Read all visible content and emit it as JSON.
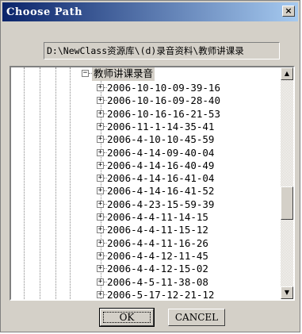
{
  "window": {
    "title": "Choose Path",
    "close_glyph": "×"
  },
  "path": "D:\\NewClass资源库\\(d)录音资料\\教师讲课录",
  "tree": {
    "root": {
      "expander": "−",
      "label": "教师讲课录音"
    },
    "items": [
      "2006-10-10-09-39-16",
      "2006-10-16-09-28-40",
      "2006-10-16-16-21-53",
      "2006-11-1-14-35-41",
      "2006-4-10-10-45-59",
      "2006-4-14-09-40-04",
      "2006-4-14-16-40-49",
      "2006-4-14-16-41-04",
      "2006-4-14-16-41-52",
      "2006-4-23-15-59-39",
      "2006-4-4-11-14-15",
      "2006-4-4-11-15-12",
      "2006-4-4-11-16-26",
      "2006-4-4-12-11-45",
      "2006-4-4-12-15-02",
      "2006-4-5-11-38-08",
      "2006-5-17-12-21-12"
    ],
    "item_expander": "+"
  },
  "scrollbar": {
    "up_glyph": "▲",
    "down_glyph": "▼"
  },
  "buttons": {
    "ok": "OK",
    "cancel": "CANCEL"
  }
}
